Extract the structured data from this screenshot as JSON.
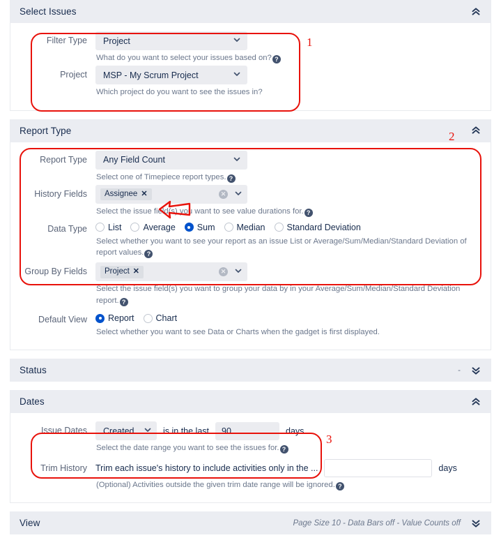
{
  "sections": [
    {
      "id": "select-issues",
      "title": "Select Issues",
      "state": "expanded",
      "summary": "",
      "rows": [
        {
          "label": "Filter Type",
          "control": "select",
          "value": "Project",
          "hint": "What do you want to select your issues based on?"
        },
        {
          "label": "Project",
          "control": "select",
          "value": "MSP - My Scrum Project",
          "hint": "Which project do you want to see the issues in?"
        }
      ]
    },
    {
      "id": "report-type",
      "title": "Report Type",
      "state": "expanded",
      "summary": "",
      "rows": [
        {
          "label": "Report Type",
          "control": "select",
          "value": "Any Field Count",
          "hint": "Select one of Timepiece report types."
        },
        {
          "label": "History Fields",
          "control": "multiselect",
          "chips": [
            "Assignee"
          ],
          "hint": "Select the issue field(s) you want to see value durations for."
        },
        {
          "label": "Data Type",
          "control": "radio",
          "options": [
            "List",
            "Average",
            "Sum",
            "Median",
            "Standard Deviation"
          ],
          "selected": "Sum",
          "hint": "Select whether you want to see your report as an issue List or Average/Sum/Median/Standard Deviation of report values."
        },
        {
          "label": "Group By Fields",
          "control": "multiselect",
          "chips": [
            "Project"
          ],
          "hint": "Select the issue field(s) you want to group your data by in your Average/Sum/Median/Standard Deviation report."
        },
        {
          "label": "Default View",
          "control": "radio",
          "options": [
            "Report",
            "Chart"
          ],
          "selected": "Report",
          "hint": "Select whether you want to see Data or Charts when the gadget is first displayed."
        }
      ]
    },
    {
      "id": "status",
      "title": "Status",
      "state": "collapsed",
      "summary": "-"
    },
    {
      "id": "dates",
      "title": "Dates",
      "state": "expanded",
      "summary": "",
      "rows": [
        {
          "label": "Issue Dates",
          "control": "date-range",
          "date_field": "Created...",
          "operator_text": "is in the last",
          "amount": "90",
          "unit": "days",
          "hint": "Select the date range you want to see the issues for."
        },
        {
          "label": "Trim History",
          "control": "trim",
          "description": "Trim each issue's history to include activities only in the ...",
          "amount": "",
          "amount_placeholder": "",
          "unit": "days",
          "hint": "(Optional) Activities outside the given trim date range will be ignored."
        }
      ]
    },
    {
      "id": "view",
      "title": "View",
      "state": "collapsed",
      "summary": "Page Size 10 - Data Bars off - Value Counts off"
    }
  ],
  "annotations": {
    "numbers": [
      "1",
      "2",
      "3"
    ],
    "arrow": "left-pointing-arrow",
    "color": "#e8120b"
  },
  "icons": {
    "collapse": "double-chevron-up-icon",
    "expand": "double-chevron-down-icon",
    "dropdown": "chevron-down-icon",
    "help": "help-circle-icon",
    "clear": "clear-circle-icon",
    "chip_remove": "chip-remove-icon"
  },
  "theme": {
    "accent": "#0052cc",
    "header_bg": "#ebedf2",
    "field_bg": "#ebecf0",
    "text": "#172b4d",
    "hint_text": "#6b778c",
    "annotation_red": "#e8120b"
  }
}
